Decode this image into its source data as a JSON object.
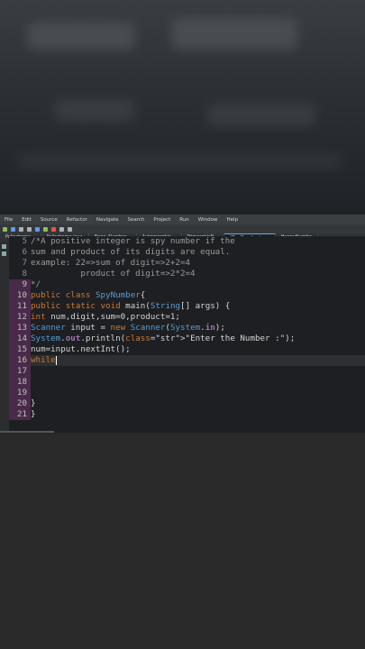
{
  "menu": [
    "File",
    "Edit",
    "Source",
    "Refactor",
    "Navigate",
    "Search",
    "Project",
    "Run",
    "Window",
    "Help"
  ],
  "tabs": [
    {
      "label": "Palindrome...",
      "active": false
    },
    {
      "label": "Palindrome.java",
      "active": false
    },
    {
      "label": "Neon_Number...",
      "active": false
    },
    {
      "label": "Automorphic...",
      "active": false
    },
    {
      "label": "TrimorphicN...",
      "active": false
    },
    {
      "label": "*SpyNumber.java",
      "active": true
    },
    {
      "label": "HappyNumbe",
      "active": false
    }
  ],
  "code_lines": [
    {
      "num": "5",
      "text": "/*A positive integer is spy number if the"
    },
    {
      "num": "6",
      "text": "sum and product of its digits are equal."
    },
    {
      "num": "7",
      "text": "example: 22=>sum of digit=>2+2=4"
    },
    {
      "num": "8",
      "text": "          product of digit=>2*2=4"
    },
    {
      "num": "9",
      "text": "*/"
    },
    {
      "num": "10",
      "text": "public class SpyNumber{"
    },
    {
      "num": "11",
      "text": "public static void main(String[] args) {"
    },
    {
      "num": "12",
      "text": "int num,digit,sum=0,product=1;"
    },
    {
      "num": "13",
      "text": "Scanner input = new Scanner(System.in);"
    },
    {
      "num": "14",
      "text": "System.out.println(\"Enter the Number :\");"
    },
    {
      "num": "15",
      "text": "num=input.nextInt();"
    },
    {
      "num": "16",
      "text": "while"
    },
    {
      "num": "17",
      "text": ""
    },
    {
      "num": "18",
      "text": ""
    },
    {
      "num": "19",
      "text": ""
    },
    {
      "num": "20",
      "text": "}"
    },
    {
      "num": "21",
      "text": "}"
    }
  ]
}
